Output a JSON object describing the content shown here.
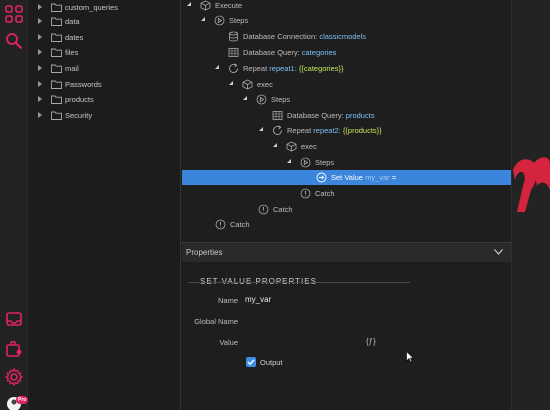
{
  "file_tree": {
    "items": [
      {
        "label": "custom_queries"
      },
      {
        "label": "data"
      },
      {
        "label": "dates"
      },
      {
        "label": "files"
      },
      {
        "label": "mail"
      },
      {
        "label": "Passwords"
      },
      {
        "label": "products"
      },
      {
        "label": "Security"
      }
    ]
  },
  "steps_tree": {
    "execute": "Execute",
    "steps": "Steps",
    "db_conn_prefix": "Database Connection:",
    "db_conn_value": "classicmodels",
    "db_query1_prefix": "Database Query:",
    "db_query1_value": "categories",
    "repeat1_prefix": "Repeat",
    "repeat1_name": "repeat1:",
    "repeat1_expr": "{{categories}}",
    "exec1": "exec",
    "steps2": "Steps",
    "db_query2_prefix": "Database Query:",
    "db_query2_value": "products",
    "repeat2_prefix": "Repeat",
    "repeat2_name": "repeat2:",
    "repeat2_expr": "{{products}}",
    "exec2": "exec",
    "steps3": "Steps",
    "setvalue_label": "Set Value",
    "setvalue_var": "my_var",
    "setvalue_eq": "=",
    "catch3": "Catch",
    "catch2": "Catch",
    "catch1": "Catch"
  },
  "properties": {
    "header": "Properties",
    "section_title": "SET VALUE PROPERTIES",
    "name_label": "Name",
    "name_value": "my_var",
    "global_name_label": "Global Name",
    "value_label": "Value",
    "value_icon": "{ƒ}",
    "output_label": "Output",
    "output_checked": true
  },
  "activity_bar": {
    "icons": [
      "apps-grid-icon",
      "search-icon",
      "inbox-icon",
      "plugin-icon",
      "settings-gear-icon",
      "user-avatar-icon"
    ],
    "pro_badge": "Pro",
    "accent": "#e0245e"
  },
  "colors": {
    "selection": "#3c85dd",
    "highlight_text": "#7ec0f5",
    "expression_text": "#c7e85c"
  }
}
